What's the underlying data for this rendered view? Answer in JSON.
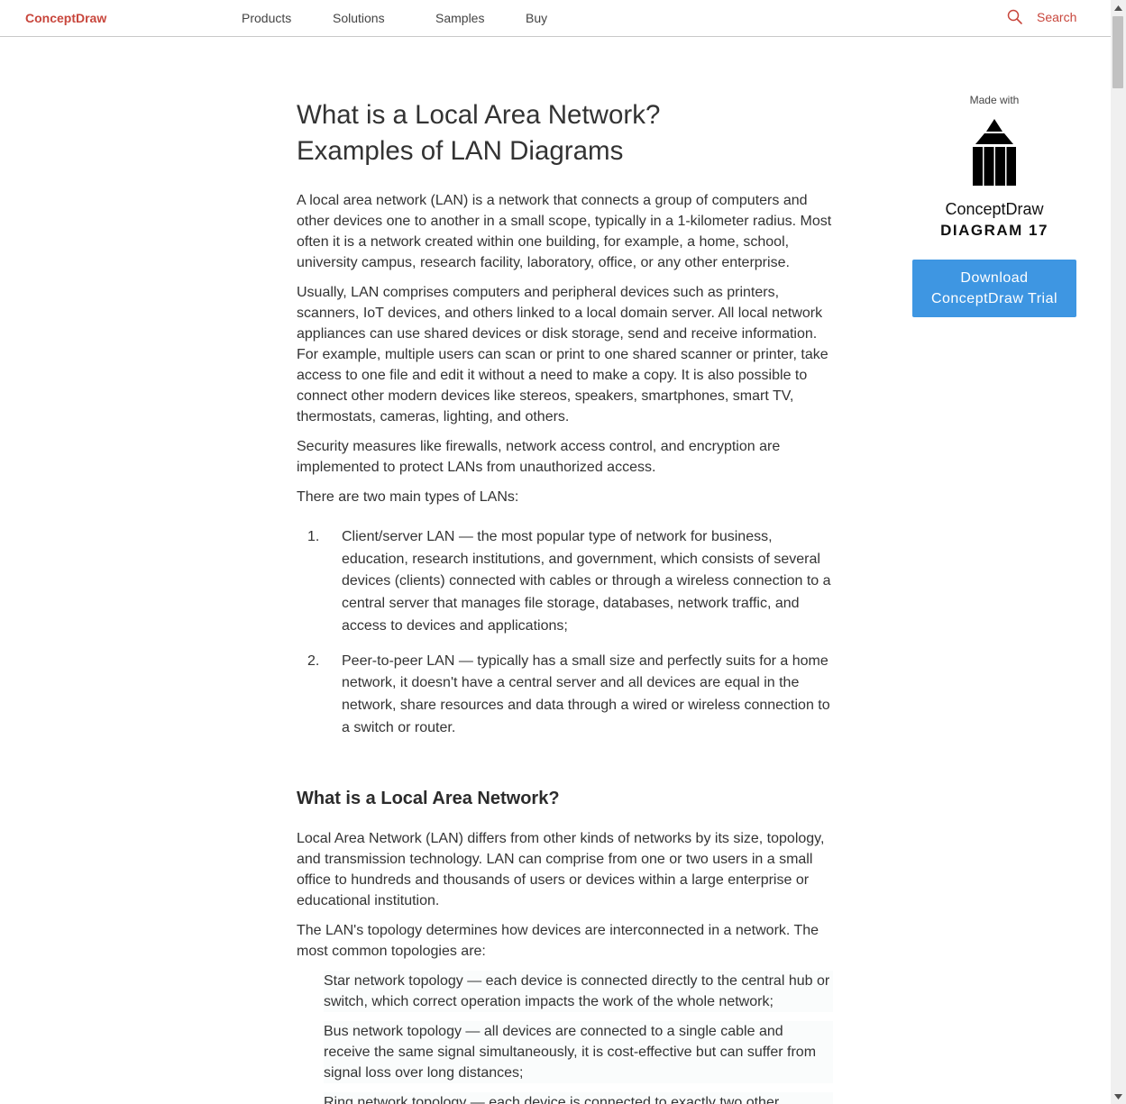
{
  "nav": {
    "logo": "ConceptDraw",
    "links": [
      "Products",
      "Solutions",
      "Samples",
      "Buy"
    ],
    "search_label": "Search"
  },
  "article": {
    "title_line1": "What is a Local Area Network?",
    "title_line2": "Examples of LAN Diagrams",
    "paragraphs": [
      "A local area network (LAN) is a network that connects a group of computers and other devices one to another in a small scope, typically in a 1-kilometer radius. Most often it is a network created within one building, for example, a home, school, university campus, research facility, laboratory, office, or any other enterprise.",
      "Usually, LAN comprises computers and peripheral devices such as printers, scanners, IoT devices, and others linked to a local domain server. All local network appliances can use shared devices or disk storage, send and receive information. For example, multiple users can scan or print to one shared scanner or printer, take access to one file and edit it without a need to make a copy. It is also possible to connect other modern devices like stereos, speakers, smartphones, smart TV, thermostats, cameras, lighting, and others.",
      "Security measures like firewalls, network access control, and encryption are implemented to protect LANs from unauthorized access.",
      "There are two main types of LANs:"
    ],
    "list": [
      {
        "num": "1.",
        "text": "Client/server LAN — the most popular type of network for business, education, research institutions, and government, which consists of several devices (clients) connected with cables or through a wireless connection to a central server that manages file storage, databases, network traffic, and access to devices and applications;"
      },
      {
        "num": "2.",
        "text": "Peer-to-peer LAN — typically has a small size and perfectly suits for a home network, it doesn't have a central server and all devices are equal in the network, share resources and data through a wired or wireless connection to a switch or router."
      }
    ],
    "section_heading": "What is a Local Area Network?",
    "section_paragraphs": [
      "Local Area Network (LAN) differs from other kinds of networks by its size, topology, and transmission technology. LAN can comprise from one or two users in a small office to hundreds and thousands of users or devices within a large enterprise or educational institution.",
      "The LAN's topology determines how devices are interconnected in a network. The most common topologies are:"
    ],
    "topologies": [
      "Star network topology — each device is connected directly to the central hub or switch, which correct operation impacts the work of the whole network;",
      "Bus network topology — all devices are connected to a single cable and receive the same signal simultaneously, it is cost-effective but can suffer from signal loss over long distances;",
      "Ring network topology — each device is connected to exactly two other"
    ]
  },
  "sidebar": {
    "made_with": "Made with",
    "product_name": "ConceptDraw",
    "product_version": "DIAGRAM 17",
    "download_line1": "Download",
    "download_line2": "ConceptDraw Trial"
  },
  "colors": {
    "brand": "#c8463c",
    "button": "#3e96e2",
    "text": "#333333"
  }
}
